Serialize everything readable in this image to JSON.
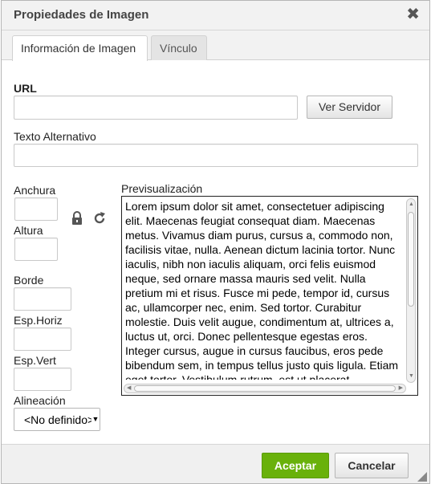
{
  "dialog": {
    "title": "Propiedades de Imagen",
    "close_glyph": "✖"
  },
  "tabs": [
    {
      "label": "Información de Imagen",
      "active": true
    },
    {
      "label": "Vínculo",
      "active": false
    }
  ],
  "form": {
    "url_label": "URL",
    "url_value": "",
    "browse_label": "Ver Servidor",
    "alt_label": "Texto Alternativo",
    "alt_value": "",
    "width_label": "Anchura",
    "height_label": "Altura",
    "border_label": "Borde",
    "hspace_label": "Esp.Horiz",
    "vspace_label": "Esp.Vert",
    "align_label": "Alineación",
    "align_value": "<No definido>",
    "lock_icon": "lock-icon",
    "reset_icon": "reset-size-icon"
  },
  "preview": {
    "label": "Previsualización",
    "text": "Lorem ipsum dolor sit amet, consectetuer adipiscing elit. Maecenas feugiat consequat diam. Maecenas metus. Vivamus diam purus, cursus a, commodo non, facilisis vitae, nulla. Aenean dictum lacinia tortor. Nunc iaculis, nibh non iaculis aliquam, orci felis euismod neque, sed ornare massa mauris sed velit. Nulla pretium mi et risus. Fusce mi pede, tempor id, cursus ac, ullamcorper nec, enim. Sed tortor. Curabitur molestie. Duis velit augue, condimentum at, ultrices a, luctus ut, orci. Donec pellentesque egestas eros. Integer cursus, augue in cursus faucibus, eros pede bibendum sem, in tempus tellus justo quis ligula. Etiam eget tortor. Vestibulum rutrum, est ut placerat"
  },
  "footer": {
    "ok_label": "Aceptar",
    "cancel_label": "Cancelar"
  },
  "colors": {
    "accent": "#69b10b"
  }
}
